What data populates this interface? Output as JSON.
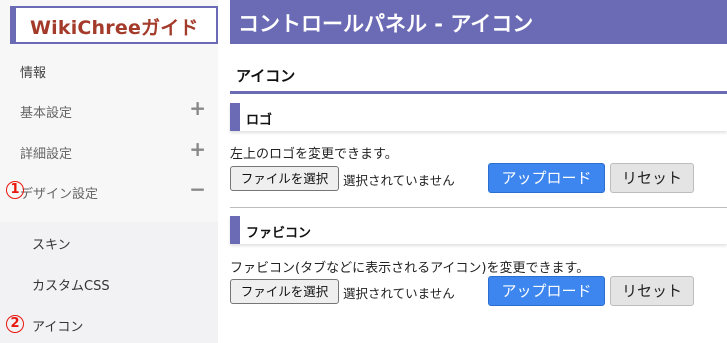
{
  "sidebar": {
    "logo": "WikiChreeガイド",
    "items": [
      {
        "label": "情報",
        "toggle": ""
      },
      {
        "label": "基本設定",
        "toggle": "+"
      },
      {
        "label": "詳細設定",
        "toggle": "+"
      },
      {
        "label": "デザイン設定",
        "toggle": "−"
      }
    ],
    "subitems": [
      {
        "label": "スキン"
      },
      {
        "label": "カスタムCSS"
      },
      {
        "label": "アイコン"
      }
    ],
    "markers": [
      "1",
      "2"
    ]
  },
  "header": {
    "title": "コントロールパネル - アイコン"
  },
  "section": {
    "title": "アイコン"
  },
  "logo_panel": {
    "heading": "ロゴ",
    "description": "左上のロゴを変更できます。",
    "file_button": "ファイルを選択",
    "file_status": "選択されていません",
    "upload": "アップロード",
    "reset": "リセット"
  },
  "favicon_panel": {
    "heading": "ファビコン",
    "description": "ファビコン(タブなどに表示されるアイコン)を変更できます。",
    "file_button": "ファイルを選択",
    "file_status": "選択されていません",
    "upload": "アップロード",
    "reset": "リセット"
  },
  "colors": {
    "accent": "#6b6bb5",
    "logo_text": "#a33a2a",
    "upload_button": "#3d86f0",
    "marker": "#e8160c"
  }
}
